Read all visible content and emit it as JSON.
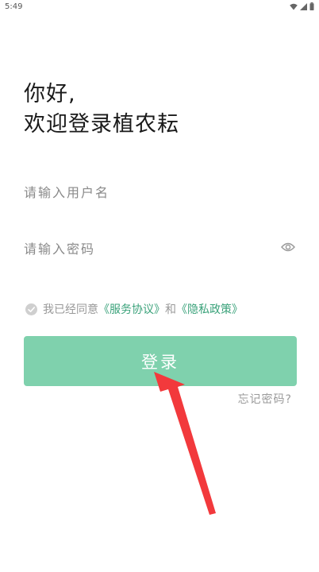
{
  "status_bar": {
    "time": "5:49",
    "icons": [
      "wifi-icon",
      "signal-icon",
      "battery-icon"
    ]
  },
  "greeting": {
    "line1": "你好,",
    "line2": "欢迎登录植农耘"
  },
  "form": {
    "username_placeholder": "请输入用户名",
    "password_placeholder": "请输入密码",
    "password_toggle_icon": "eye-icon"
  },
  "agreement": {
    "prefix": "我已经同意",
    "service_link": "《服务协议》",
    "and": "和",
    "privacy_link": "《隐私政策》"
  },
  "login_label": "登录",
  "forgot_password": "忘记密码?",
  "colors": {
    "accent": "#7fd1ad",
    "link": "#3aa27a",
    "arrow": "#f2393c"
  }
}
